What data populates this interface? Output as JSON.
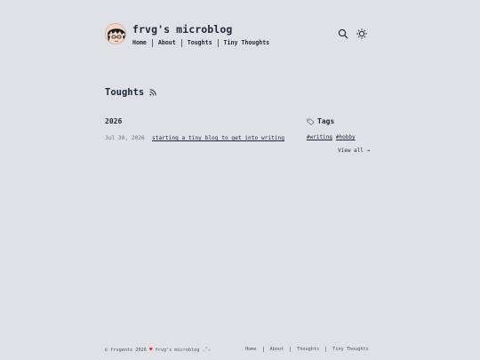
{
  "site": {
    "title": "frvg's microblog"
  },
  "nav": {
    "items": [
      "Home",
      "About",
      "Toughts",
      "Tiny Thoughts"
    ]
  },
  "header_icons": [
    "search-icon",
    "sun-icon"
  ],
  "page": {
    "heading": "Toughts"
  },
  "posts": {
    "year": "2026",
    "items": [
      {
        "date": "Jul 30, 2026",
        "title": "starting a tiny blog to get into writing"
      }
    ]
  },
  "tags": {
    "heading": "Tags",
    "items": [
      "#writing",
      "#hobby"
    ],
    "view_all": "View all →"
  },
  "footer": {
    "copyright": "© frvgents 2026",
    "heart": "♥",
    "tagline": "frvg's microblog .˚✧",
    "nav": [
      "Home",
      "About",
      "Thoughts",
      "Tiny Thoughts"
    ]
  },
  "colors": {
    "background": "#dfe1e6",
    "text": "#1f2736",
    "muted": "#6b7280",
    "heart": "#e0233b"
  }
}
